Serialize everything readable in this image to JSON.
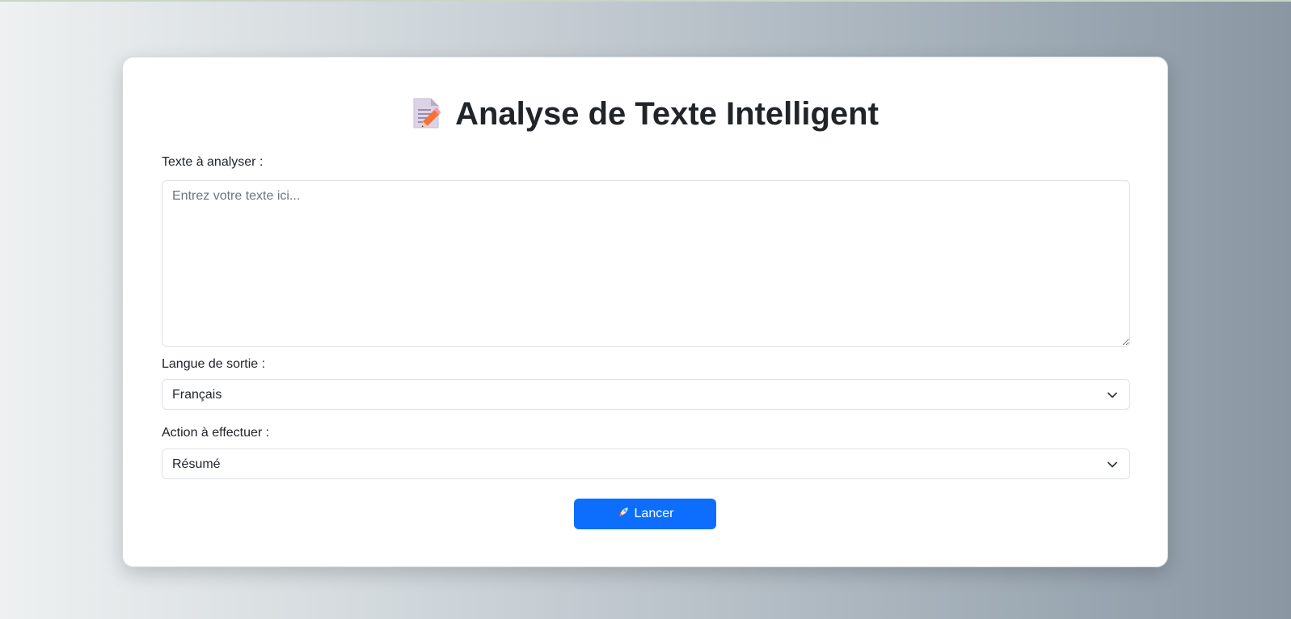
{
  "page": {
    "title": "Analyse de Texte Intelligent",
    "title_icon": "memo-icon"
  },
  "form": {
    "text_label": "Texte à analyser :",
    "text_placeholder": "Entrez votre texte ici...",
    "text_value": "",
    "language_label": "Langue de sortie :",
    "language_value": "Français",
    "action_label": "Action à effectuer :",
    "action_value": "Résumé",
    "submit_label": "Lancer",
    "submit_icon": "rocket-icon"
  },
  "colors": {
    "accent": "#0d6efd",
    "card_background": "#ffffff",
    "text": "#212529"
  }
}
